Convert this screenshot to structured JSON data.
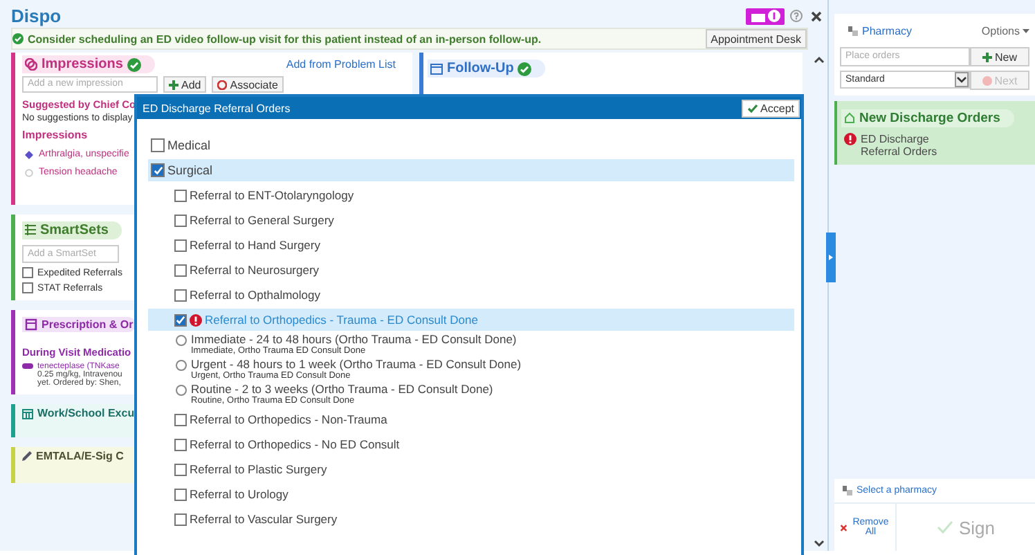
{
  "header": {
    "title": "Dispo"
  },
  "banner": {
    "text": "Consider scheduling an ED video follow-up visit for this patient instead of an in-person follow-up.",
    "button": "Appointment Desk"
  },
  "impressions": {
    "title": "Impressions",
    "complete": true,
    "link": "Add from Problem List",
    "placeholder": "Add a new impression",
    "add_label": "Add",
    "associate_label": "Associate",
    "suggested_heading": "Suggested by Chief Co",
    "suggestions_empty": "No suggestions to display",
    "list_heading": "Impressions",
    "items": [
      {
        "label": "Arthralgia, unspecifie",
        "primary": true
      },
      {
        "label": "Tension headache",
        "primary": false
      }
    ]
  },
  "smartsets": {
    "title": "SmartSets",
    "placeholder": "Add a SmartSet",
    "options": [
      {
        "label": "Expedited Referrals",
        "checked": false
      },
      {
        "label": "STAT Referrals",
        "checked": false
      }
    ]
  },
  "prescription": {
    "title": "Prescription & Or",
    "heading": "During Visit Medicatio",
    "med_lines": [
      "tenecteplase (TNKase",
      "0.25 mg/kg, Intravenou",
      "yet. Ordered by: Shen,"
    ]
  },
  "work_school": {
    "title": "Work/School Excu"
  },
  "emtala": {
    "title": "EMTALA/E-Sig C"
  },
  "follow_up": {
    "title": "Follow-Up",
    "complete": true
  },
  "dialog": {
    "title": "ED Discharge Referral Orders",
    "accept_label": "Accept",
    "items": [
      {
        "kind": "category",
        "label": "Medical",
        "checked": false,
        "selected": false
      },
      {
        "kind": "category",
        "label": "Surgical",
        "checked": true,
        "selected": true
      },
      {
        "kind": "order",
        "label": "Referral to ENT-Otolaryngology",
        "checked": false,
        "selected": false,
        "alert": false
      },
      {
        "kind": "order",
        "label": "Referral to General Surgery",
        "checked": false,
        "selected": false,
        "alert": false
      },
      {
        "kind": "order",
        "label": "Referral to Hand Surgery",
        "checked": false,
        "selected": false,
        "alert": false
      },
      {
        "kind": "order",
        "label": "Referral to Neurosurgery",
        "checked": false,
        "selected": false,
        "alert": false
      },
      {
        "kind": "order",
        "label": "Referral to Opthalmology",
        "checked": false,
        "selected": false,
        "alert": false
      },
      {
        "kind": "order",
        "label": "Referral to Orthopedics - Trauma - ED Consult Done",
        "checked": true,
        "selected": true,
        "alert": true,
        "options": [
          {
            "label": "Immediate - 24 to 48 hours (Ortho Trauma - ED Consult Done)",
            "detail": "Immediate, Ortho Trauma ED Consult Done",
            "selected": false
          },
          {
            "label": "Urgent - 48 hours to 1 week (Ortho Trauma - ED Consult Done)",
            "detail": "Urgent, Ortho Trauma ED Consult Done",
            "selected": false
          },
          {
            "label": "Routine - 2 to 3 weeks (Ortho Trauma - ED Consult Done)",
            "detail": "Routine, Ortho Trauma ED Consult Done",
            "selected": false
          }
        ]
      },
      {
        "kind": "order",
        "label": "Referral to Orthopedics - Non-Trauma",
        "checked": false,
        "selected": false,
        "alert": false
      },
      {
        "kind": "order",
        "label": "Referral to Orthopedics - No ED Consult",
        "checked": false,
        "selected": false,
        "alert": false
      },
      {
        "kind": "order",
        "label": "Referral to Plastic Surgery",
        "checked": false,
        "selected": false,
        "alert": false
      },
      {
        "kind": "order",
        "label": "Referral to Urology",
        "checked": false,
        "selected": false,
        "alert": false
      },
      {
        "kind": "order",
        "label": "Referral to Vascular Surgery",
        "checked": false,
        "selected": false,
        "alert": false
      }
    ]
  },
  "sidebar": {
    "pharmacy_link": "Pharmacy",
    "options_label": "Options",
    "order_placeholder": "Place orders",
    "new_label": "New",
    "order_class": "Standard",
    "next_label": "Next",
    "next_disabled": true,
    "group": {
      "title": "New Discharge Orders",
      "items": [
        {
          "label": "ED Discharge Referral Orders",
          "alert": true
        }
      ]
    },
    "select_pharmacy": "Select a pharmacy",
    "remove_label": "Remove All",
    "sign_label": "Sign",
    "sign_disabled": true
  }
}
